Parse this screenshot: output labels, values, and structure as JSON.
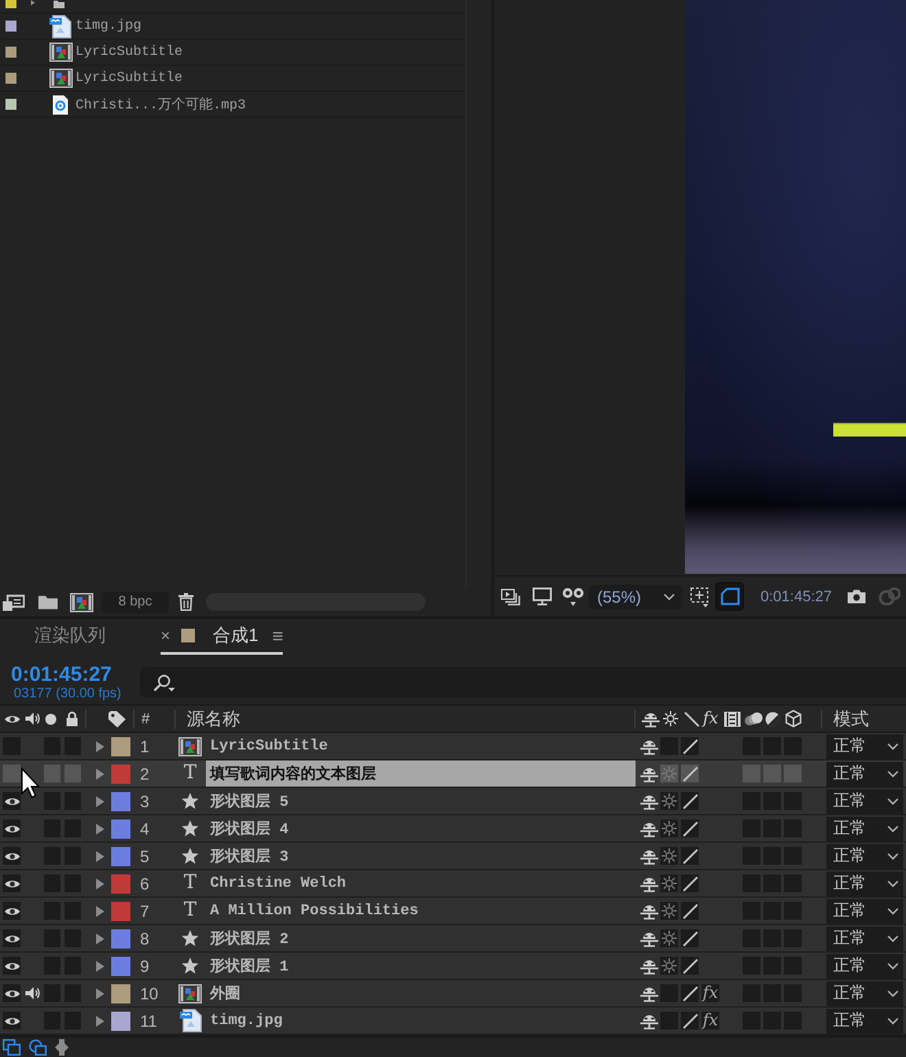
{
  "project": {
    "items": [
      {
        "kind": "folder",
        "color": "#d6c33c",
        "cut_off": true
      },
      {
        "kind": "image",
        "name": "timg.jpg",
        "color": "#a9a7cf",
        "cut_off": false
      },
      {
        "kind": "comp",
        "name": "LyricSubtitle",
        "color": "#ad9c7d",
        "cut_off": false
      },
      {
        "kind": "comp",
        "name": "LyricSubtitle",
        "color": "#ad9c7d",
        "cut_off": false
      },
      {
        "kind": "audio",
        "name": "Christi...万个可能.mp3",
        "color": "#b6c8b2",
        "cut_off": false
      }
    ],
    "bit_depth": "8 bpc"
  },
  "viewer": {
    "magnification": "(55%)",
    "timecode": "0:01:45:27",
    "roi_on": true
  },
  "tabs": [
    {
      "label": "渲染队列",
      "selected": false
    },
    {
      "label": "合成1",
      "selected": true,
      "color": "#ad9c7d",
      "close": "×",
      "menu": "≡"
    }
  ],
  "timeline": {
    "current_time": "0:01:45:27",
    "frame_info": "03177 (30.00 fps)",
    "columns": {
      "number": "#",
      "source_name": "源名称",
      "effects": "fx",
      "mode": "模式"
    },
    "layers": [
      {
        "number": "1",
        "name": "LyricSubtitle",
        "kind": "comp",
        "color": "#ad9c7d",
        "visible": false,
        "audio": false,
        "selected": false,
        "collapse": false,
        "mode": "正常"
      },
      {
        "number": "2",
        "name": "填写歌词内容的文本图层",
        "kind": "text",
        "glyph": "T",
        "color": "#c03a3a",
        "visible": false,
        "audio": false,
        "selected": true,
        "collapse": true,
        "mode": "正常"
      },
      {
        "number": "3",
        "name": "形状图层 5",
        "kind": "shape",
        "color": "#6b7ee0",
        "visible": true,
        "audio": false,
        "selected": false,
        "collapse": true,
        "mode": "正常"
      },
      {
        "number": "4",
        "name": "形状图层 4",
        "kind": "shape",
        "color": "#6b7ee0",
        "visible": true,
        "audio": false,
        "selected": false,
        "collapse": true,
        "mode": "正常"
      },
      {
        "number": "5",
        "name": "形状图层 3",
        "kind": "shape",
        "color": "#6b7ee0",
        "visible": true,
        "audio": false,
        "selected": false,
        "collapse": true,
        "mode": "正常"
      },
      {
        "number": "6",
        "name": "Christine Welch",
        "kind": "text",
        "glyph": "T",
        "color": "#c03a3a",
        "visible": true,
        "audio": false,
        "selected": false,
        "collapse": true,
        "mode": "正常"
      },
      {
        "number": "7",
        "name": "A Million Possibilities",
        "kind": "text",
        "glyph": "T",
        "color": "#c03a3a",
        "visible": true,
        "audio": false,
        "selected": false,
        "collapse": true,
        "mode": "正常"
      },
      {
        "number": "8",
        "name": "形状图层 2",
        "kind": "shape",
        "color": "#6b7ee0",
        "visible": true,
        "audio": false,
        "selected": false,
        "collapse": true,
        "mode": "正常"
      },
      {
        "number": "9",
        "name": "形状图层 1",
        "kind": "shape",
        "color": "#6b7ee0",
        "visible": true,
        "audio": false,
        "selected": false,
        "collapse": true,
        "mode": "正常"
      },
      {
        "number": "10",
        "name": "外圈",
        "kind": "comp",
        "color": "#ad9c7d",
        "visible": true,
        "audio": true,
        "selected": false,
        "collapse": false,
        "fx": "fx",
        "mode": "正常"
      },
      {
        "number": "11",
        "name": "timg.jpg",
        "kind": "image",
        "color": "#a9a7cf",
        "visible": true,
        "audio": false,
        "selected": false,
        "collapse": false,
        "fx": "fx",
        "mode": "正常"
      }
    ]
  }
}
